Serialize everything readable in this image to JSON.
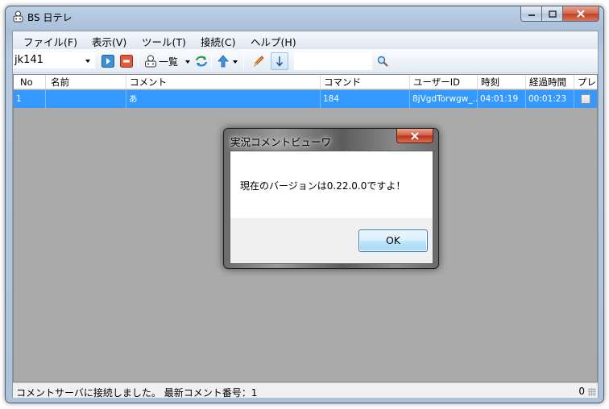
{
  "window": {
    "title": "BS 日テレ"
  },
  "menu": {
    "items": [
      "ファイル(F)",
      "表示(V)",
      "ツール(T)",
      "接続(C)",
      "ヘルプ(H)"
    ]
  },
  "toolbar": {
    "channel_value": "jk141",
    "list_label": "一覧",
    "search_value": ""
  },
  "list": {
    "columns": [
      "No",
      "名前",
      "コメント",
      "コマンド",
      "ユーザーID",
      "時刻",
      "経過時間",
      "プレ"
    ],
    "rows": [
      {
        "no": "1",
        "name": "",
        "comment": "あ",
        "command": "184",
        "user_id": "8jVgdTorwgw_...",
        "time": "04:01:19",
        "elapsed": "00:01:23",
        "premium": false
      }
    ]
  },
  "status": {
    "message": "コメントサーバに接続しました。 最新コメント番号：1",
    "count": "0"
  },
  "dialog": {
    "title": "実況コメントビューワ",
    "message": "現在のバージョンは0.22.0.0ですよ！",
    "ok_label": "OK"
  },
  "colors": {
    "selection": "#3399ff",
    "list_background": "#aaaaaa",
    "close_button": "#c13e23"
  },
  "icons": [
    "app-icon",
    "play-icon",
    "stop-icon",
    "cookie-icon",
    "refresh-icon",
    "up-arrow-icon",
    "pen-icon",
    "down-arrow-icon",
    "search-icon"
  ]
}
